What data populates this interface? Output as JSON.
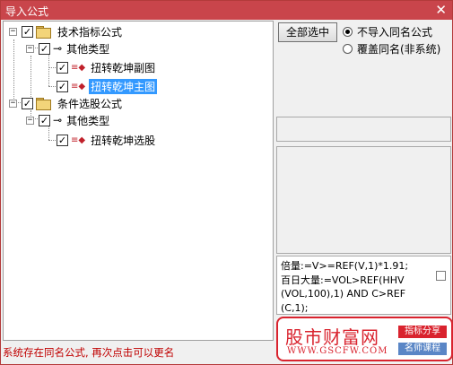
{
  "window": {
    "title": "导入公式",
    "close_glyph": "✕"
  },
  "tree": {
    "nodes": [
      {
        "label": "技术指标公式",
        "checked": true,
        "expanded": true
      },
      {
        "label": "其他类型",
        "checked": true,
        "expanded": true
      },
      {
        "label": "扭转乾坤副图",
        "checked": true
      },
      {
        "label": "扭转乾坤主图",
        "checked": true,
        "selected": true
      },
      {
        "label": "条件选股公式",
        "checked": true,
        "expanded": true
      },
      {
        "label": "其他类型",
        "checked": true,
        "expanded": true
      },
      {
        "label": "扭转乾坤选股",
        "checked": true
      }
    ],
    "expander_glyph": "−",
    "check_glyph": "✓"
  },
  "options": {
    "select_all_label": "全部选中",
    "radio_no_import": "不导入同名公式",
    "radio_overwrite": "覆盖同名(非系统)",
    "selected": "no_import"
  },
  "preview": {
    "lines": [
      "倍量:=V>=REF(V,1)*1.91;",
      "百日大量:=VOL>REF(HHV",
      "(VOL,100),1) AND C>REF",
      "(C,1);"
    ]
  },
  "status_text": "系统存在同名公式, 再次点击可以更名",
  "watermark": {
    "brand": "股市财富网",
    "url": "WWW.GSCFW.COM",
    "tag1": "指标分享",
    "tag2": "名师课程",
    "color_red": "#d9232e",
    "color_blue": "#5a86c6"
  },
  "icons": {
    "folder": "folder-icon",
    "key": "key-icon",
    "formula": "formula-pen-icon"
  }
}
